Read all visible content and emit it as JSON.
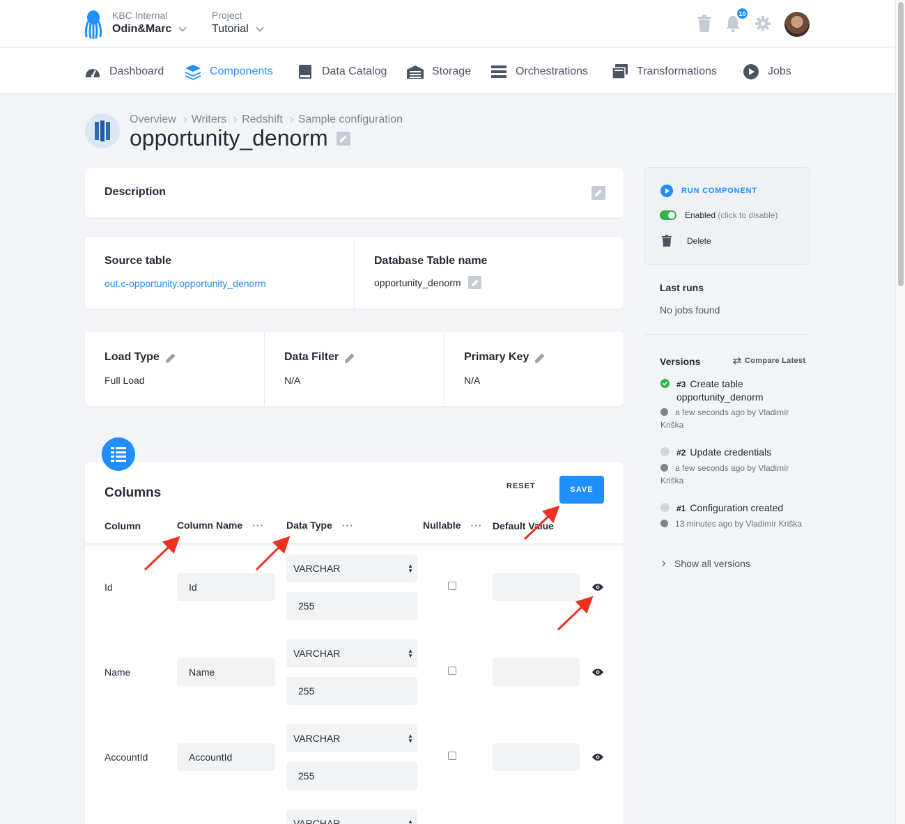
{
  "header": {
    "org_label": "KBC Internal",
    "org_name": "Odin&Marc",
    "project_label": "Project",
    "project_name": "Tutorial",
    "notifications_count": "10"
  },
  "nav": {
    "items": [
      {
        "label": "Dashboard",
        "icon": "dashboard-icon"
      },
      {
        "label": "Components",
        "icon": "layers-icon",
        "active": true
      },
      {
        "label": "Data Catalog",
        "icon": "book-icon"
      },
      {
        "label": "Storage",
        "icon": "warehouse-icon"
      },
      {
        "label": "Orchestrations",
        "icon": "bars-icon"
      },
      {
        "label": "Transformations",
        "icon": "window-icon"
      },
      {
        "label": "Jobs",
        "icon": "play-circle-icon"
      }
    ]
  },
  "breadcrumb": [
    "Overview",
    "Writers",
    "Redshift",
    "Sample configuration"
  ],
  "page_title": "opportunity_denorm",
  "description": {
    "title": "Description"
  },
  "source": {
    "source_title": "Source table",
    "source_value": "out.c-opportunity.opportunity_denorm",
    "db_title": "Database Table name",
    "db_value": "opportunity_denorm"
  },
  "settings": {
    "load_type_title": "Load Type",
    "load_type_value": "Full Load",
    "filter_title": "Data Filter",
    "filter_value": "N/A",
    "pk_title": "Primary Key",
    "pk_value": "N/A"
  },
  "columns": {
    "title": "Columns",
    "reset_label": "RESET",
    "save_label": "SAVE",
    "headers": {
      "column": "Column",
      "name": "Column Name",
      "type": "Data Type",
      "nullable": "Nullable",
      "default": "Default Value"
    },
    "rows": [
      {
        "column": "Id",
        "name": "Id",
        "type": "VARCHAR",
        "size": "255"
      },
      {
        "column": "Name",
        "name": "Name",
        "type": "VARCHAR",
        "size": "255"
      },
      {
        "column": "AccountId",
        "name": "AccountId",
        "type": "VARCHAR",
        "size": "255"
      },
      {
        "column": "",
        "name": "",
        "type": "VARCHAR",
        "size": ""
      }
    ]
  },
  "sidebar": {
    "run_label": "RUN COMPONENT",
    "enabled_label": "Enabled",
    "enabled_hint": "(click to disable)",
    "delete_label": "Delete",
    "last_runs_title": "Last runs",
    "last_runs_empty": "No jobs found",
    "versions_title": "Versions",
    "compare_label": "Compare Latest",
    "versions": [
      {
        "num": "#3",
        "desc": "Create table opportunity_denorm",
        "meta": "a few seconds ago by Vladimír Kriška",
        "status": "current"
      },
      {
        "num": "#2",
        "desc": "Update credentials",
        "meta": "a few seconds ago by Vladimír Kriška",
        "status": "old"
      },
      {
        "num": "#1",
        "desc": "Configuration created",
        "meta": "13 minutes ago by Vladimír Kriška",
        "status": "old"
      }
    ],
    "show_all_label": "Show all versions"
  },
  "colors": {
    "accent": "#1f8fff",
    "success": "#2cb44b",
    "annotation_arrow": "#f0301e"
  }
}
